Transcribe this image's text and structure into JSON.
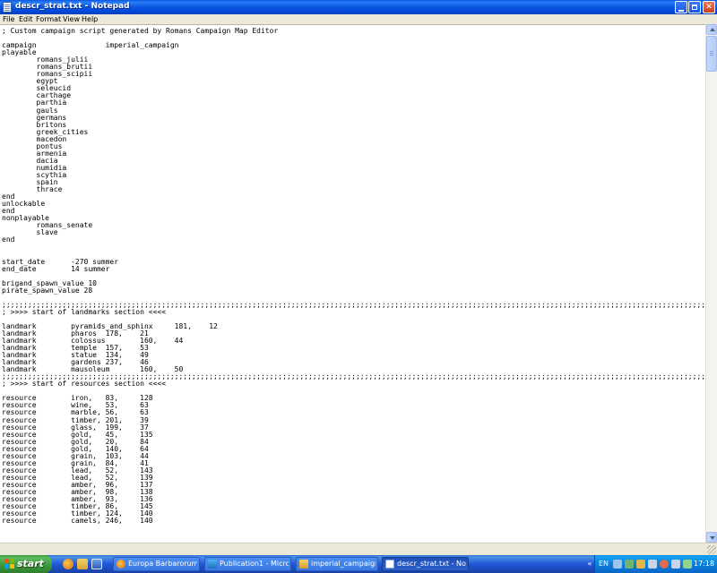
{
  "window": {
    "title": "descr_strat.txt - Notepad",
    "menu": [
      "File",
      "Edit",
      "Format",
      "View",
      "Help"
    ]
  },
  "document": {
    "lines": [
      "; Custom campaign script generated by Romans Campaign Map Editor",
      "",
      "campaign                imperial_campaign",
      "playable",
      "        romans_julii",
      "        romans_brutii",
      "        romans_scipii",
      "        egypt",
      "        seleucid",
      "        carthage",
      "        parthia",
      "        gauls",
      "        germans",
      "        britons",
      "        greek_cities",
      "        macedon",
      "        pontus",
      "        armenia",
      "        dacia",
      "        numidia",
      "        scythia",
      "        spain",
      "        thrace",
      "end",
      "unlockable",
      "end",
      "nonplayable",
      "        romans_senate",
      "        slave",
      "end",
      "",
      "",
      "start_date      -270 summer",
      "end_date        14 summer",
      "",
      "brigand_spawn_value 10",
      "pirate_spawn_value 28",
      "",
      ";;;;;;;;;;;;;;;;;;;;;;;;;;;;;;;;;;;;;;;;;;;;;;;;;;;;;;;;;;;;;;;;;;;;;;;;;;;;;;;;;;;;;;;;;;;;;;;;;;;;;;;;;;;;;;;;;;;;;;;;;;;;;;;;;;;;;;;;;;;;;;;;;;;;;;;;;;;;;;;;;;;;;;;;;;",
      "; >>>> start of landmarks section <<<<",
      "",
      "landmark        pyramids_and_sphinx     181,    12",
      "landmark        pharos  178,    21",
      "landmark        colossus        160,    44",
      "landmark        temple  157,    53",
      "landmark        statue  134,    49",
      "landmark        gardens 237,    46",
      "landmark        mausoleum       160,    50",
      ";;;;;;;;;;;;;;;;;;;;;;;;;;;;;;;;;;;;;;;;;;;;;;;;;;;;;;;;;;;;;;;;;;;;;;;;;;;;;;;;;;;;;;;;;;;;;;;;;;;;;;;;;;;;;;;;;;;;;;;;;;;;;;;;;;;;;;;;;;;;;;;;;;;;;;;;;;;;;;;;;;;;;;;;;;",
      "; >>>> start of resources section <<<<",
      "",
      "resource        iron,   83,     128",
      "resource        wine,   53,     63",
      "resource        marble, 56,     63",
      "resource        timber, 201,    39",
      "resource        glass,  199,    37",
      "resource        gold,   45,     135",
      "resource        gold,   20,     84",
      "resource        gold,   140,    64",
      "resource        grain,  103,    44",
      "resource        grain,  84,     41",
      "resource        lead,   52,     143",
      "resource        lead,   52,     139",
      "resource        amber,  96,     137",
      "resource        amber,  98,     138",
      "resource        amber,  93,     136",
      "resource        timber, 86,     145",
      "resource        timber, 124,    140",
      "resource        camels, 246,    140"
    ]
  },
  "taskbar": {
    "start_label": "start",
    "tasks": [
      {
        "label": "Europa Barbarorum - ...",
        "active": false
      },
      {
        "label": "Publication1 - Microso...",
        "active": false
      },
      {
        "label": "imperial_campaign",
        "active": false
      },
      {
        "label": "descr_strat.txt - Not...",
        "active": true
      }
    ],
    "language": "EN",
    "clock": "17:18"
  }
}
